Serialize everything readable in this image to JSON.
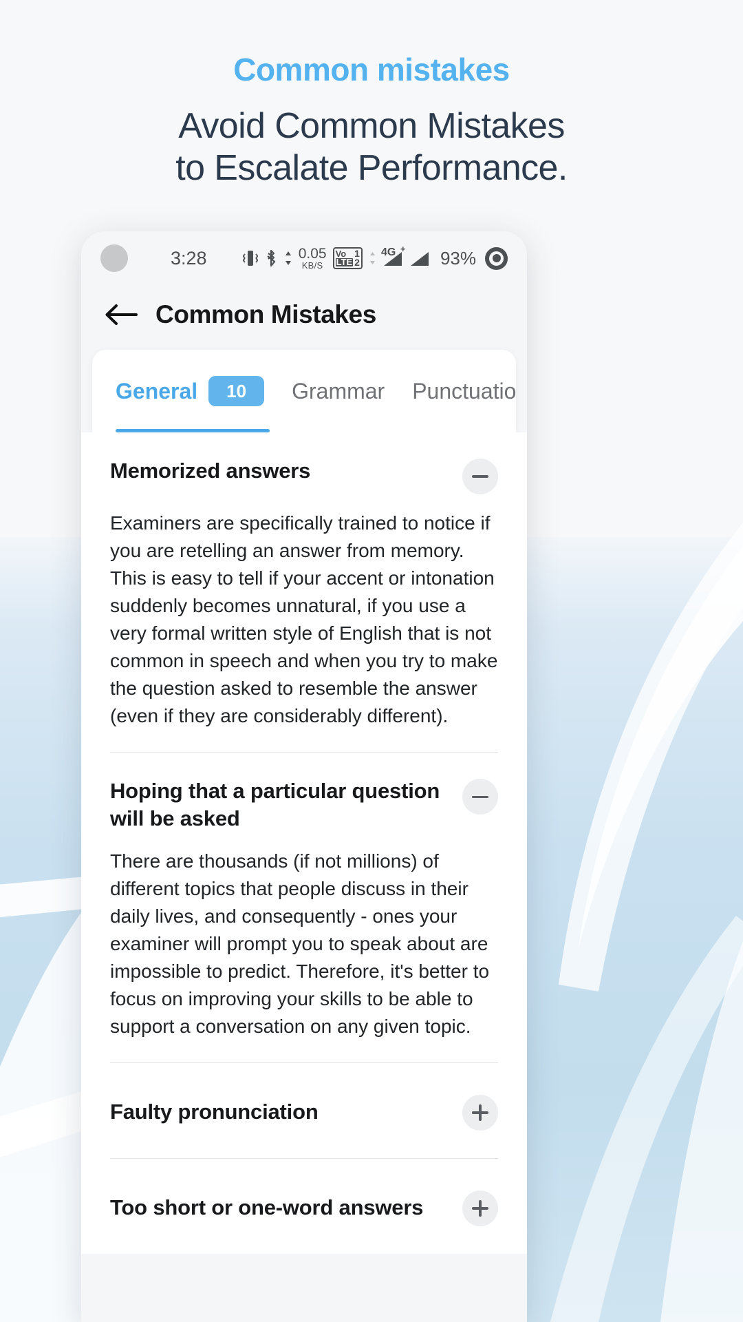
{
  "promo": {
    "eyebrow": "Common mistakes",
    "headline_line1": "Avoid Common Mistakes",
    "headline_line2": "to Escalate Performance.",
    "accent_color": "#54b3ee",
    "headline_color": "#2b3a4d"
  },
  "statusbar": {
    "time": "3:28",
    "net_speed_value": "0.05",
    "net_speed_unit": "KB/S",
    "volte_label": "Vo",
    "volte_lte": "LTE",
    "sim1": "1",
    "sim2": "2",
    "network": "4G",
    "network_plus": "+",
    "battery_percent": "93%",
    "icons": [
      "vibrate-icon",
      "bluetooth-icon",
      "data-transfer-icon",
      "volte-icon",
      "signal-icon-1",
      "signal-icon-2",
      "battery-saver-icon"
    ]
  },
  "appbar": {
    "back_icon": "arrow-left-icon",
    "title": "Common Mistakes"
  },
  "tabs": [
    {
      "label": "General",
      "badge": "10",
      "active": true
    },
    {
      "label": "Grammar",
      "badge": "",
      "active": false
    },
    {
      "label": "Punctuation",
      "badge": "",
      "active": false
    }
  ],
  "accordions": [
    {
      "title": "Memorized answers",
      "expanded": true,
      "toggle_icon": "minus-icon",
      "body": "Examiners are specifically trained to notice if you are retelling an answer from memory. This is easy to tell if your accent or intonation suddenly becomes unnatural, if you use a very formal written style of English that is not common in speech and when you try to make the question asked to resemble the answer (even if they are considerably different)."
    },
    {
      "title": "Hoping that a particular question will be asked",
      "expanded": true,
      "toggle_icon": "minus-icon",
      "body": "There are thousands (if not millions) of different topics that people discuss in their daily lives, and consequently - ones your examiner will prompt you to speak about are impossible to predict. Therefore, it's better to focus on improving your skills to be able to support a conversation on any given topic."
    },
    {
      "title": "Faulty pronunciation",
      "expanded": false,
      "toggle_icon": "plus-icon",
      "body": ""
    },
    {
      "title": "Too short or one-word answers",
      "expanded": false,
      "toggle_icon": "plus-icon",
      "body": ""
    }
  ]
}
